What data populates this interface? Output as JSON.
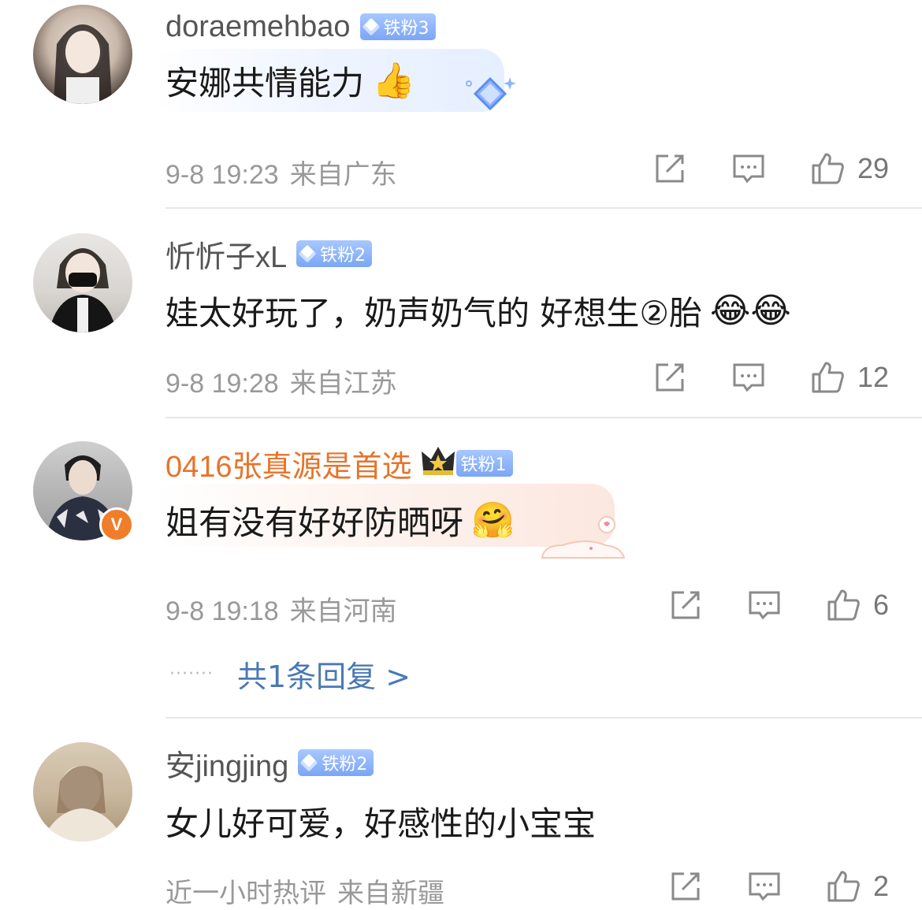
{
  "colors": {
    "username_gray": "#555555",
    "username_orange": "#e8732a",
    "meta_gray": "#999999",
    "reply_blue": "#4a78b5",
    "badge_blue": "#7ba6f5",
    "verified_orange": "#f07d2a",
    "divider": "#e8e8e8"
  },
  "comments": [
    {
      "username": "doraemehbao",
      "badge": "铁粉3",
      "text": "安娜共情能力",
      "emoji": "👍",
      "emoji_name": "thumbs-up-icon",
      "time": "9-8 19:23",
      "location": "来自广东",
      "likes": "29"
    },
    {
      "username": "忻忻子xL",
      "badge": "铁粉2",
      "text": "娃太好玩了，奶声奶气的 好想生②胎",
      "emoji": "😂😂",
      "emoji_name": "laughing-tears-icon",
      "time": "9-8 19:28",
      "location": "来自江苏",
      "likes": "12"
    },
    {
      "username": "0416张真源是首选",
      "badge": "铁粉1",
      "text": "姐有没有好好防晒呀",
      "emoji": "🤗",
      "emoji_name": "flower-face-icon",
      "verified_mark": "V",
      "time": "9-8 19:18",
      "location": "来自河南",
      "likes": "6",
      "reply_dots": "·······",
      "reply_link": "共1条回复 >"
    },
    {
      "username": "安jingjing",
      "badge": "铁粉2",
      "text": "女儿好可爱，好感性的小宝宝",
      "time": "近一小时热评",
      "location": "来自新疆",
      "likes": "2"
    }
  ]
}
